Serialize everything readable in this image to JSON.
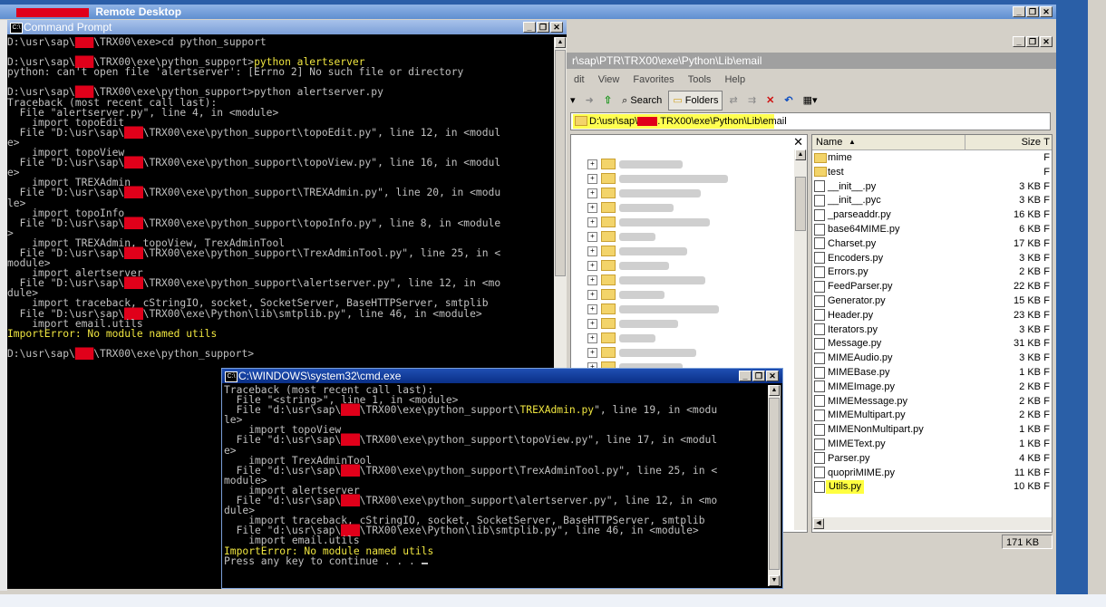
{
  "remote_desktop": {
    "title": "Remote Desktop",
    "buttons": [
      "_",
      "❐",
      "✕"
    ]
  },
  "cmd1": {
    "title": "Command Prompt",
    "lines": [
      "D:\\usr\\sap\\[R]\\TRX00\\exe>cd python_support",
      "",
      "D:\\usr\\sap\\[R]\\TRX00\\exe\\python_support>{python alertserver}",
      "python: can't open file 'alertserver': [Errno 2] No such file or directory",
      "",
      "D:\\usr\\sap\\[R]\\TRX00\\exe\\python_support>python alertserver.py",
      "Traceback (most recent call last):",
      "  File \"alertserver.py\", line 4, in <module>",
      "    import topoEdit",
      "  File \"D:\\usr\\sap\\[R]\\TRX00\\exe\\python_support\\topoEdit.py\", line 12, in <modul",
      "e>",
      "    import topoView",
      "  File \"D:\\usr\\sap\\[R]\\TRX00\\exe\\python_support\\topoView.py\", line 16, in <modul",
      "e>",
      "    import TREXAdmin",
      "  File \"D:\\usr\\sap\\[R]\\TRX00\\exe\\python_support\\TREXAdmin.py\", line 20, in <modu",
      "le>",
      "    import topoInfo",
      "  File \"D:\\usr\\sap\\[R]\\TRX00\\exe\\python_support\\topoInfo.py\", line 8, in <module",
      ">",
      "    import TREXAdmin, topoView, TrexAdminTool",
      "  File \"D:\\usr\\sap\\[R]\\TRX00\\exe\\python_support\\TrexAdminTool.py\", line 25, in <",
      "module>",
      "    import alertserver",
      "  File \"D:\\usr\\sap\\[R]\\TRX00\\exe\\python_support\\alertserver.py\", line 12, in <mo",
      "dule>",
      "    import traceback, cStringIO, socket, SocketServer, BaseHTTPServer, smtplib",
      "  File \"D:\\usr\\sap\\[R]\\TRX00\\exe\\Python\\lib\\smtplib.py\", line 46, in <module>",
      "    import email.utils",
      "{ImportError: No module named utils}",
      "",
      "D:\\usr\\sap\\[R]\\TRX00\\exe\\python_support>"
    ]
  },
  "cmd2": {
    "title": "C:\\WINDOWS\\system32\\cmd.exe",
    "lines": [
      "Traceback (most recent call last):",
      "  File \"<string>\", line 1, in <module>",
      "  File \"d:\\usr\\sap\\[R]\\TRX00\\exe\\python_support\\{TREXAdmin.py}\", line 19, in <modu",
      "le>",
      "    import topoView",
      "  File \"d:\\usr\\sap\\[R]\\TRX00\\exe\\python_support\\topoView.py\", line 17, in <modul",
      "e>",
      "    import TrexAdminTool",
      "  File \"d:\\usr\\sap\\[R]\\TRX00\\exe\\python_support\\TrexAdminTool.py\", line 25, in <",
      "module>",
      "    import alertserver",
      "  File \"d:\\usr\\sap\\[R]\\TRX00\\exe\\python_support\\alertserver.py\", line 12, in <mo",
      "dule>",
      "    import traceback, cStringIO, socket, SocketServer, BaseHTTPServer, smtplib",
      "  File \"d:\\usr\\sap\\[R]\\TRX00\\exe\\Python\\lib\\smtplib.py\", line 46, in <module>",
      "    import email.utils",
      "{ImportError: No module named utils}",
      "Press any key to continue . . . "
    ]
  },
  "explorer": {
    "path_title": "r\\sap\\PTR\\TRX00\\exe\\Python\\Lib\\email",
    "menu": [
      "dit",
      "View",
      "Favorites",
      "Tools",
      "Help"
    ],
    "toolbar": {
      "search": "Search",
      "folders": "Folders"
    },
    "address": "D:\\usr\\sap\\[R].TRX00\\exe\\Python\\Lib\\email",
    "address_parts": {
      "pre": "D:\\usr\\sap\\",
      "post": ".TRX00\\exe\\Python\\Lib\\email"
    },
    "folder_pane_close": "✕",
    "columns": {
      "name": "Name",
      "size": "Size",
      "type": "T"
    },
    "files": [
      {
        "name": "mime",
        "size": "",
        "type": "F",
        "folder": true
      },
      {
        "name": "test",
        "size": "",
        "type": "F",
        "folder": true
      },
      {
        "name": "__init__.py",
        "size": "3 KB",
        "type": "F"
      },
      {
        "name": "__init__.pyc",
        "size": "3 KB",
        "type": "F"
      },
      {
        "name": "_parseaddr.py",
        "size": "16 KB",
        "type": "F"
      },
      {
        "name": "base64MIME.py",
        "size": "6 KB",
        "type": "F"
      },
      {
        "name": "Charset.py",
        "size": "17 KB",
        "type": "F"
      },
      {
        "name": "Encoders.py",
        "size": "3 KB",
        "type": "F"
      },
      {
        "name": "Errors.py",
        "size": "2 KB",
        "type": "F"
      },
      {
        "name": "FeedParser.py",
        "size": "22 KB",
        "type": "F"
      },
      {
        "name": "Generator.py",
        "size": "15 KB",
        "type": "F"
      },
      {
        "name": "Header.py",
        "size": "23 KB",
        "type": "F"
      },
      {
        "name": "Iterators.py",
        "size": "3 KB",
        "type": "F"
      },
      {
        "name": "Message.py",
        "size": "31 KB",
        "type": "F"
      },
      {
        "name": "MIMEAudio.py",
        "size": "3 KB",
        "type": "F"
      },
      {
        "name": "MIMEBase.py",
        "size": "1 KB",
        "type": "F"
      },
      {
        "name": "MIMEImage.py",
        "size": "2 KB",
        "type": "F"
      },
      {
        "name": "MIMEMessage.py",
        "size": "2 KB",
        "type": "F"
      },
      {
        "name": "MIMEMultipart.py",
        "size": "2 KB",
        "type": "F"
      },
      {
        "name": "MIMENonMultipart.py",
        "size": "1 KB",
        "type": "F"
      },
      {
        "name": "MIMEText.py",
        "size": "1 KB",
        "type": "F"
      },
      {
        "name": "Parser.py",
        "size": "4 KB",
        "type": "F"
      },
      {
        "name": "quopriMIME.py",
        "size": "11 KB",
        "type": "F"
      },
      {
        "name": "Utils.py",
        "size": "10 KB",
        "type": "F",
        "highlight": true
      }
    ],
    "status_size": "171 KB"
  },
  "colors": {
    "console_text": "#c0c0c0",
    "console_highlight": "#f0e640",
    "redaction": "#e0001a",
    "address_highlight": "#ffff50"
  }
}
